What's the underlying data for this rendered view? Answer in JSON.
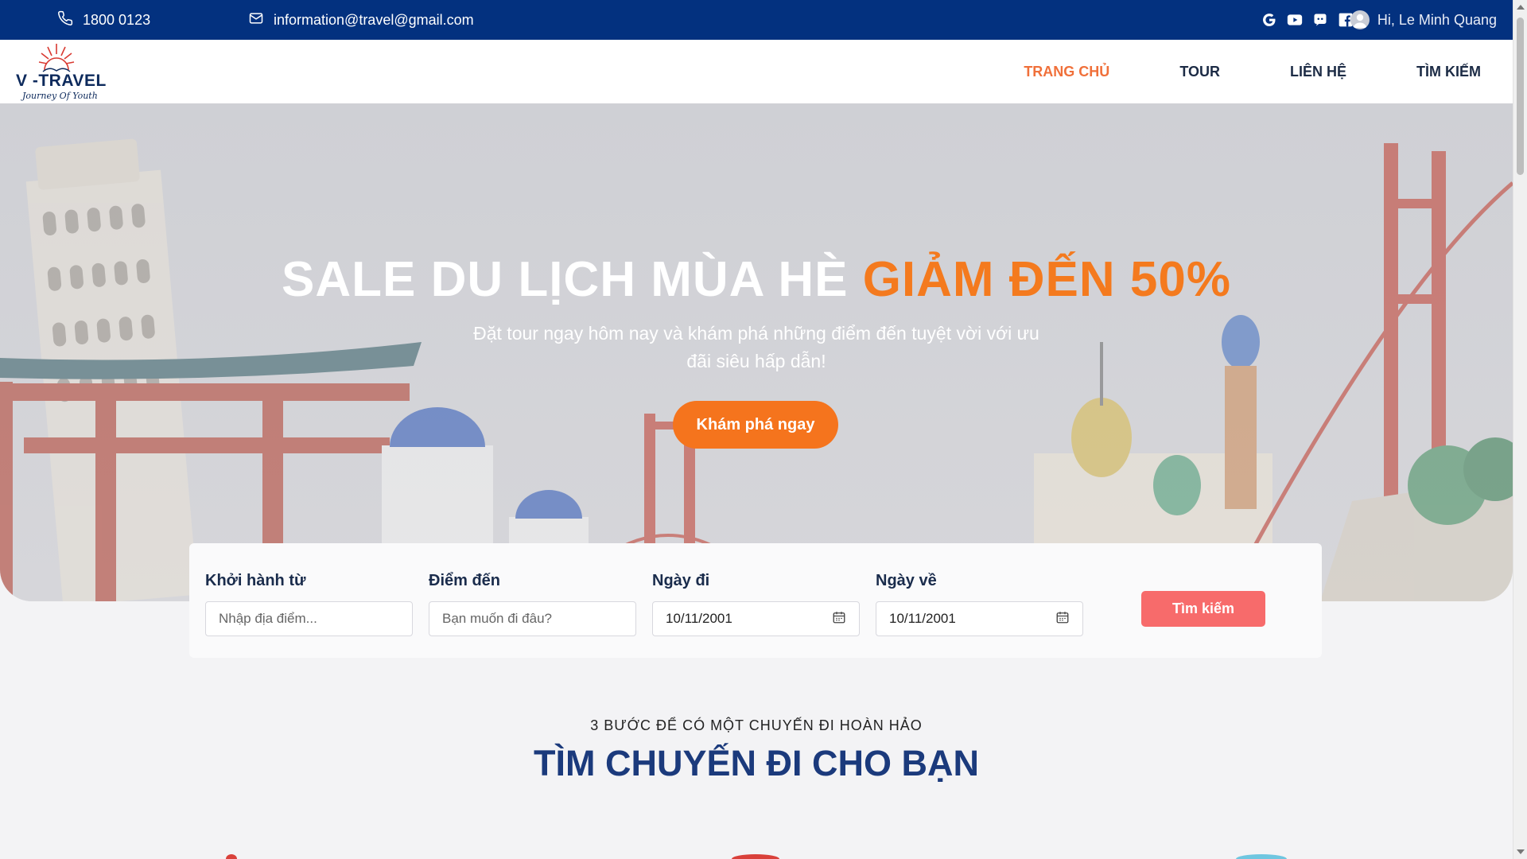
{
  "topbar": {
    "phone": "1800 0123",
    "email": "information@travel@gmail.com",
    "social_icons": [
      "google-icon",
      "youtube-icon",
      "discord-icon",
      "facebook-icon"
    ],
    "user_greeting": "Hi, Le Minh Quang"
  },
  "brand": {
    "name": "V -TRAVEL",
    "tagline": "Journey Of Youth"
  },
  "nav": {
    "items": [
      "TRANG CHỦ",
      "TOUR",
      "LIÊN HỆ",
      "TÌM KIẾM"
    ],
    "active": "TRANG CHỦ"
  },
  "hero": {
    "title_main": "SALE DU LỊCH MÙA HÈ ",
    "title_highlight": "GIẢM ĐẾN 50%",
    "subtitle": "Đặt tour ngay hôm nay và khám phá những điểm đến tuyệt vời với ưu đãi siêu hấp dẫn!",
    "cta": "Khám phá ngay"
  },
  "search": {
    "from_label": "Khởi hành từ",
    "from_placeholder": "Nhập địa điểm...",
    "to_label": "Điểm đến",
    "to_placeholder": "Bạn muốn đi đâu?",
    "depart_label": "Ngày đi",
    "depart_value": "10/11/2001",
    "return_label": "Ngày về",
    "return_value": "10/11/2001",
    "button": "Tìm kiếm"
  },
  "section": {
    "kicker": "3 BƯỚC ĐỂ CÓ MỘT CHUYẾN ĐI HOÀN HẢO",
    "title": "TÌM CHUYẾN ĐI CHO BẠN"
  },
  "colors": {
    "topbar": "#03317f",
    "accent": "#f5741d",
    "nav_active": "#f0703a",
    "search_button": "#f76b6b",
    "section_title": "#1b3a7c"
  }
}
